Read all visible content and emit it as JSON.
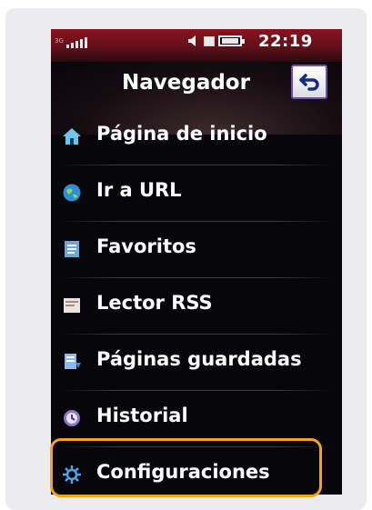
{
  "status_bar": {
    "network_label": "3G",
    "time": "22:19"
  },
  "header": {
    "title": "Navegador",
    "back_icon": "back-arrow-icon"
  },
  "menu": {
    "items": [
      {
        "label": "Página de inicio",
        "icon": "home-icon"
      },
      {
        "label": "Ir a URL",
        "icon": "globe-icon"
      },
      {
        "label": "Favoritos",
        "icon": "bookmarks-icon"
      },
      {
        "label": "Lector RSS",
        "icon": "rss-icon"
      },
      {
        "label": "Páginas guardadas",
        "icon": "saved-pages-icon"
      },
      {
        "label": "Historial",
        "icon": "history-icon"
      },
      {
        "label": "Configuraciones",
        "icon": "settings-icon"
      }
    ],
    "highlighted_item": "Configuraciones"
  },
  "colors": {
    "status_bar": "#8a1320",
    "highlight": "#f2a51c",
    "background": "#07060a",
    "card": "#ececef"
  }
}
